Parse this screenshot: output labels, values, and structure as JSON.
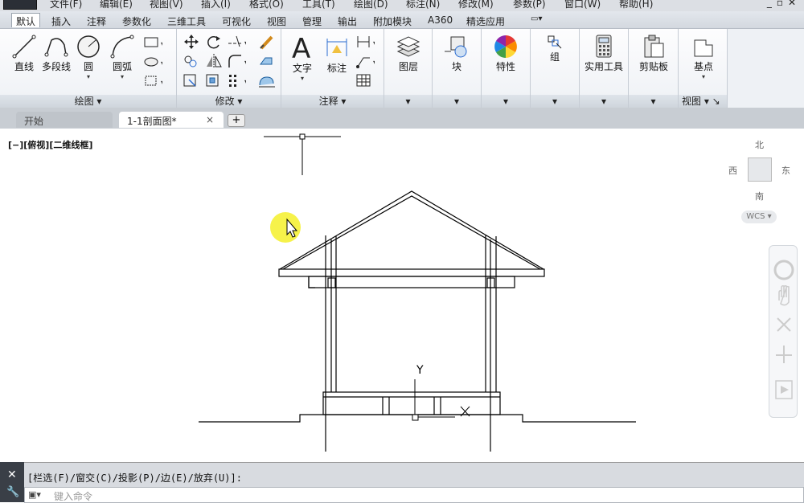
{
  "menu": [
    "文件(F)",
    "编辑(E)",
    "视图(V)",
    "插入(I)",
    "格式(O)",
    "工具(T)",
    "绘图(D)",
    "标注(N)",
    "修改(M)",
    "参数(P)",
    "窗口(W)",
    "帮助(H)"
  ],
  "ribbon_tabs": [
    "默认",
    "插入",
    "注释",
    "参数化",
    "三维工具",
    "可视化",
    "视图",
    "管理",
    "输出",
    "附加模块",
    "A360",
    "精选应用"
  ],
  "draw_panel": {
    "title": "绘图",
    "line": "直线",
    "polyline": "多段线",
    "circle": "圆",
    "arc": "圆弧"
  },
  "modify_panel": {
    "title": "修改"
  },
  "annotate_panel": {
    "title": "注释",
    "text": "文字",
    "dimension": "标注"
  },
  "layers": {
    "label": "图层"
  },
  "block": {
    "label": "块"
  },
  "properties": {
    "label": "特性"
  },
  "group": {
    "label": "组"
  },
  "utilities": {
    "label": "实用工具"
  },
  "clipboard": {
    "label": "剪贴板"
  },
  "view_panel": {
    "title": "视图",
    "base_label": "基点"
  },
  "doc_tabs": {
    "start": "开始",
    "current": "1-1剖面图*",
    "close": "×",
    "add": "+"
  },
  "viewport": {
    "label": "[−][俯视][二维线框]"
  },
  "viewcube": {
    "north": "北",
    "south": "南",
    "west": "西",
    "east": "东",
    "wcs": "WCS"
  },
  "ucs": {
    "y": "Y"
  },
  "command": {
    "prompt": "[栏选(F)/窗交(C)/投影(P)/边(E)/放弃(U)]:",
    "placeholder": "键入命令"
  },
  "colors": {
    "ribbon_bg": "#f7f8fa",
    "tab_bar": "#dde1e7",
    "line": "#000000",
    "cursor_highlight": "#f4f02a"
  }
}
